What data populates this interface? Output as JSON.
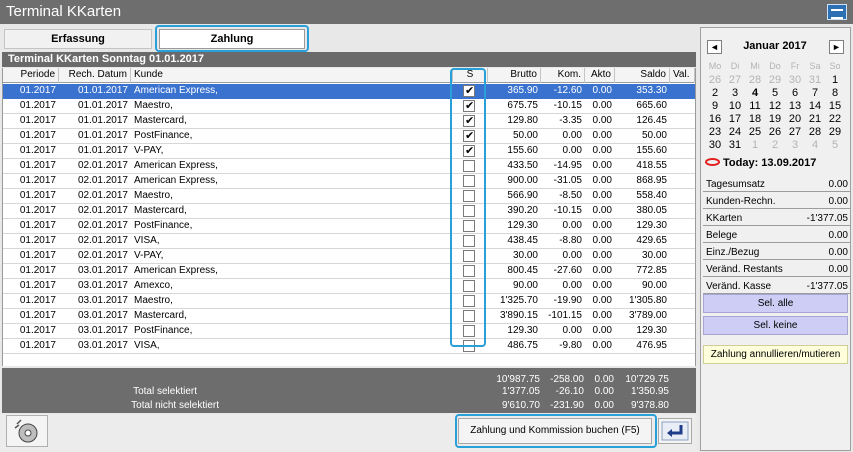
{
  "window": {
    "title": "Terminal KKarten"
  },
  "tabs": [
    {
      "label": "Erfassung"
    },
    {
      "label": "Zahlung"
    }
  ],
  "grid": {
    "title": "Terminal KKarten Sonntag 01.01.2017",
    "columns": [
      "Periode",
      "Rech. Datum",
      "Kunde",
      "S",
      "Brutto",
      "Kom.",
      "Akto",
      "Saldo",
      "Val."
    ],
    "rows": [
      {
        "periode": "01.2017",
        "datum": "01.01.2017",
        "kunde": "American Express,",
        "s": true,
        "brutto": "365.90",
        "kom": "-12.60",
        "akto": "0.00",
        "saldo": "353.30"
      },
      {
        "periode": "01.2017",
        "datum": "01.01.2017",
        "kunde": "Maestro,",
        "s": true,
        "brutto": "675.75",
        "kom": "-10.15",
        "akto": "0.00",
        "saldo": "665.60"
      },
      {
        "periode": "01.2017",
        "datum": "01.01.2017",
        "kunde": "Mastercard,",
        "s": true,
        "brutto": "129.80",
        "kom": "-3.35",
        "akto": "0.00",
        "saldo": "126.45"
      },
      {
        "periode": "01.2017",
        "datum": "01.01.2017",
        "kunde": "PostFinance,",
        "s": true,
        "brutto": "50.00",
        "kom": "0.00",
        "akto": "0.00",
        "saldo": "50.00"
      },
      {
        "periode": "01.2017",
        "datum": "01.01.2017",
        "kunde": "V-PAY,",
        "s": true,
        "brutto": "155.60",
        "kom": "0.00",
        "akto": "0.00",
        "saldo": "155.60"
      },
      {
        "periode": "01.2017",
        "datum": "02.01.2017",
        "kunde": "American Express,",
        "s": false,
        "brutto": "433.50",
        "kom": "-14.95",
        "akto": "0.00",
        "saldo": "418.55"
      },
      {
        "periode": "01.2017",
        "datum": "02.01.2017",
        "kunde": "American Express,",
        "s": false,
        "brutto": "900.00",
        "kom": "-31.05",
        "akto": "0.00",
        "saldo": "868.95"
      },
      {
        "periode": "01.2017",
        "datum": "02.01.2017",
        "kunde": "Maestro,",
        "s": false,
        "brutto": "566.90",
        "kom": "-8.50",
        "akto": "0.00",
        "saldo": "558.40"
      },
      {
        "periode": "01.2017",
        "datum": "02.01.2017",
        "kunde": "Mastercard,",
        "s": false,
        "brutto": "390.20",
        "kom": "-10.15",
        "akto": "0.00",
        "saldo": "380.05"
      },
      {
        "periode": "01.2017",
        "datum": "02.01.2017",
        "kunde": "PostFinance,",
        "s": false,
        "brutto": "129.30",
        "kom": "0.00",
        "akto": "0.00",
        "saldo": "129.30"
      },
      {
        "periode": "01.2017",
        "datum": "02.01.2017",
        "kunde": "VISA,",
        "s": false,
        "brutto": "438.45",
        "kom": "-8.80",
        "akto": "0.00",
        "saldo": "429.65"
      },
      {
        "periode": "01.2017",
        "datum": "02.01.2017",
        "kunde": "V-PAY,",
        "s": false,
        "brutto": "30.00",
        "kom": "0.00",
        "akto": "0.00",
        "saldo": "30.00"
      },
      {
        "periode": "01.2017",
        "datum": "03.01.2017",
        "kunde": "American Express,",
        "s": false,
        "brutto": "800.45",
        "kom": "-27.60",
        "akto": "0.00",
        "saldo": "772.85"
      },
      {
        "periode": "01.2017",
        "datum": "03.01.2017",
        "kunde": "Amexco,",
        "s": false,
        "brutto": "90.00",
        "kom": "0.00",
        "akto": "0.00",
        "saldo": "90.00"
      },
      {
        "periode": "01.2017",
        "datum": "03.01.2017",
        "kunde": "Maestro,",
        "s": false,
        "brutto": "1'325.70",
        "kom": "-19.90",
        "akto": "0.00",
        "saldo": "1'305.80"
      },
      {
        "periode": "01.2017",
        "datum": "03.01.2017",
        "kunde": "Mastercard,",
        "s": false,
        "brutto": "3'890.15",
        "kom": "-101.15",
        "akto": "0.00",
        "saldo": "3'789.00"
      },
      {
        "periode": "01.2017",
        "datum": "03.01.2017",
        "kunde": "PostFinance,",
        "s": false,
        "brutto": "129.30",
        "kom": "0.00",
        "akto": "0.00",
        "saldo": "129.30"
      },
      {
        "periode": "01.2017",
        "datum": "03.01.2017",
        "kunde": "VISA,",
        "s": false,
        "brutto": "486.75",
        "kom": "-9.80",
        "akto": "0.00",
        "saldo": "476.95"
      }
    ]
  },
  "totals": [
    {
      "label": "",
      "brutto": "10'987.75",
      "kom": "-258.00",
      "akto": "0.00",
      "saldo": "10'729.75"
    },
    {
      "label": "Total selektiert",
      "brutto": "1'377.05",
      "kom": "-26.10",
      "akto": "0.00",
      "saldo": "1'350.95"
    },
    {
      "label": "Total nicht selektiert",
      "brutto": "9'610.70",
      "kom": "-231.90",
      "akto": "0.00",
      "saldo": "9'378.80"
    }
  ],
  "buttons": {
    "book": "Zahlung und Kommission buchen (F5)"
  },
  "calendar": {
    "prev": "◄",
    "next": "►",
    "month": "Januar 2017",
    "weekdays": [
      "Mo",
      "Di",
      "Mi",
      "Do",
      "Fr",
      "Sa",
      "So"
    ],
    "weeks": [
      [
        "26",
        "27",
        "28",
        "29",
        "30",
        "31",
        "1"
      ],
      [
        "2",
        "3",
        "4",
        "5",
        "6",
        "7",
        "8"
      ],
      [
        "9",
        "10",
        "11",
        "12",
        "13",
        "14",
        "15"
      ],
      [
        "16",
        "17",
        "18",
        "19",
        "20",
        "21",
        "22"
      ],
      [
        "23",
        "24",
        "25",
        "26",
        "27",
        "28",
        "29"
      ],
      [
        "30",
        "31",
        "1",
        "2",
        "3",
        "4",
        "5"
      ]
    ],
    "today": "Today: 13.09.2017"
  },
  "stats": [
    {
      "label": "Tagesumsatz",
      "value": "0.00"
    },
    {
      "label": "Kunden-Rechn.",
      "value": "0.00"
    },
    {
      "label": "KKarten",
      "value": "-1'377.05"
    },
    {
      "label": "Belege",
      "value": "0.00"
    },
    {
      "label": "Einz./Bezug",
      "value": "0.00"
    },
    {
      "label": "Veränd. Restants",
      "value": "0.00"
    },
    {
      "label": "Veränd. Kasse",
      "value": "-1'377.05"
    }
  ],
  "side_buttons": {
    "select_all": "Sel. alle",
    "select_none": "Sel. keine",
    "annul": "Zahlung annullieren/mutieren"
  }
}
